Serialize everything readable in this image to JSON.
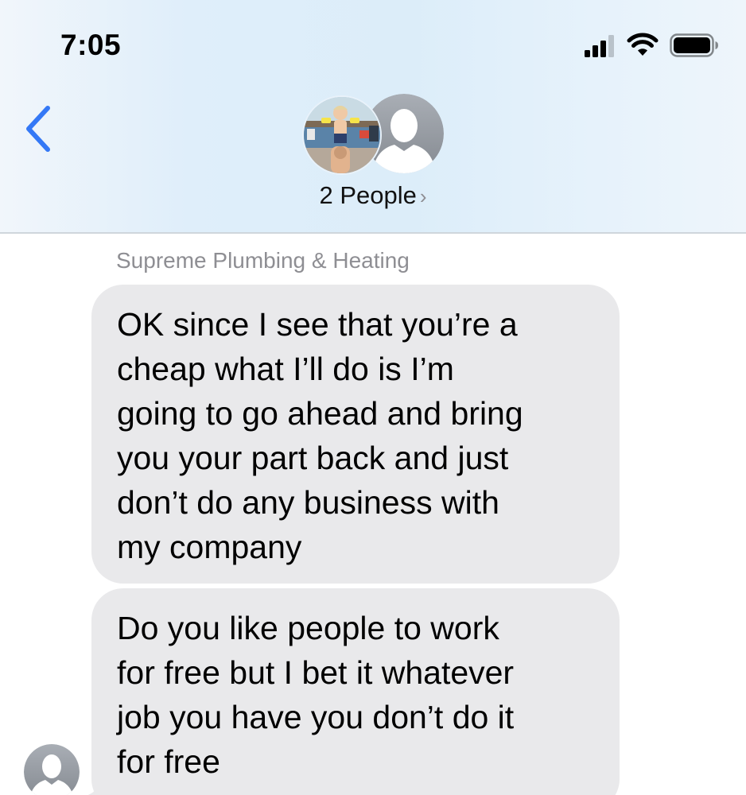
{
  "status_bar": {
    "time": "7:05",
    "signal_icon": "cellular-signal-icon",
    "wifi_icon": "wifi-icon",
    "battery_icon": "battery-icon"
  },
  "header": {
    "back_icon": "chevron-left-icon",
    "people_label": "2 People",
    "people_chevron": "›",
    "avatars": [
      "group-photo-avatar",
      "person-silhouette-avatar"
    ],
    "accent_color": "#3478f6"
  },
  "conversation": {
    "sender_name": "Supreme Plumbing & Heating",
    "messages": [
      {
        "text": "OK since I see that you’re a\ncheap what I’ll do is I’m\ngoing to go ahead and bring\nyou your part back and just\ndon’t do any business with\nmy company"
      },
      {
        "text": "Do you like people to work\nfor free but I bet it whatever\njob you have you don’t do it\nfor free"
      }
    ],
    "bubble_color": "#e9e9eb"
  }
}
